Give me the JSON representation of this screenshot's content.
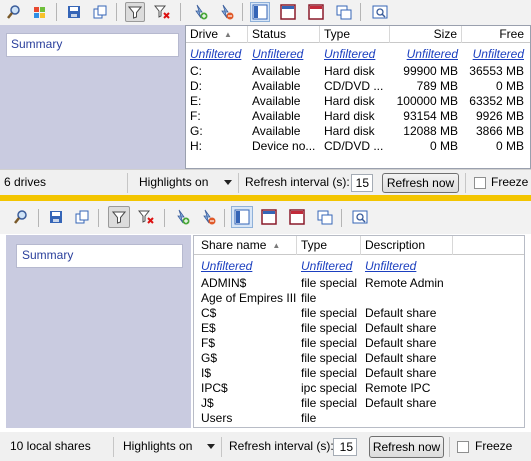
{
  "drives_pane": {
    "sidebar": {
      "summary_label": "Summary"
    },
    "columns": [
      {
        "label": "Drive",
        "sorted": true
      },
      {
        "label": "Status"
      },
      {
        "label": "Type"
      },
      {
        "label": "Size"
      },
      {
        "label": "Free"
      }
    ],
    "filter_row": [
      "Unfiltered",
      "Unfiltered",
      "Unfiltered",
      "Unfiltered",
      "Unfiltered"
    ],
    "rows": [
      [
        "C:",
        "Available",
        "Hard disk",
        "99900 MB",
        "36553 MB"
      ],
      [
        "D:",
        "Available",
        "CD/DVD ...",
        "789 MB",
        "0 MB"
      ],
      [
        "E:",
        "Available",
        "Hard disk",
        "100000 MB",
        "63352 MB"
      ],
      [
        "F:",
        "Available",
        "Hard disk",
        "93154 MB",
        "9926 MB"
      ],
      [
        "G:",
        "Available",
        "Hard disk",
        "12088 MB",
        "3866 MB"
      ],
      [
        "H:",
        "Device no...",
        "CD/DVD ...",
        "0 MB",
        "0 MB"
      ]
    ],
    "status": {
      "count": "6 drives",
      "highlights": "Highlights on",
      "refresh_label": "Refresh interval (s):",
      "refresh_value": "15",
      "refresh_button": "Refresh now",
      "freeze": "Freeze"
    }
  },
  "shares_pane": {
    "sidebar": {
      "summary_label": "Summary"
    },
    "columns": [
      {
        "label": "Share name",
        "sorted": true
      },
      {
        "label": "Type"
      },
      {
        "label": "Description"
      }
    ],
    "filter_row": [
      "Unfiltered",
      "Unfiltered",
      "Unfiltered"
    ],
    "rows": [
      [
        "ADMIN$",
        "file special",
        "Remote Admin"
      ],
      [
        "Age of Empires III",
        "file",
        ""
      ],
      [
        "C$",
        "file special",
        "Default share"
      ],
      [
        "E$",
        "file special",
        "Default share"
      ],
      [
        "F$",
        "file special",
        "Default share"
      ],
      [
        "G$",
        "file special",
        "Default share"
      ],
      [
        "I$",
        "file special",
        "Default share"
      ],
      [
        "IPC$",
        "ipc special",
        "Remote IPC"
      ],
      [
        "J$",
        "file special",
        "Default share"
      ],
      [
        "Users",
        "file",
        ""
      ]
    ],
    "status": {
      "count": "10 local shares",
      "highlights": "Highlights on",
      "refresh_label": "Refresh interval (s):",
      "refresh_value": "15",
      "refresh_button": "Refresh now",
      "freeze": "Freeze"
    }
  },
  "colors": {
    "divider": "#f3c500",
    "sidebar": "#c9cbe0",
    "link": "#1b3fbf"
  }
}
